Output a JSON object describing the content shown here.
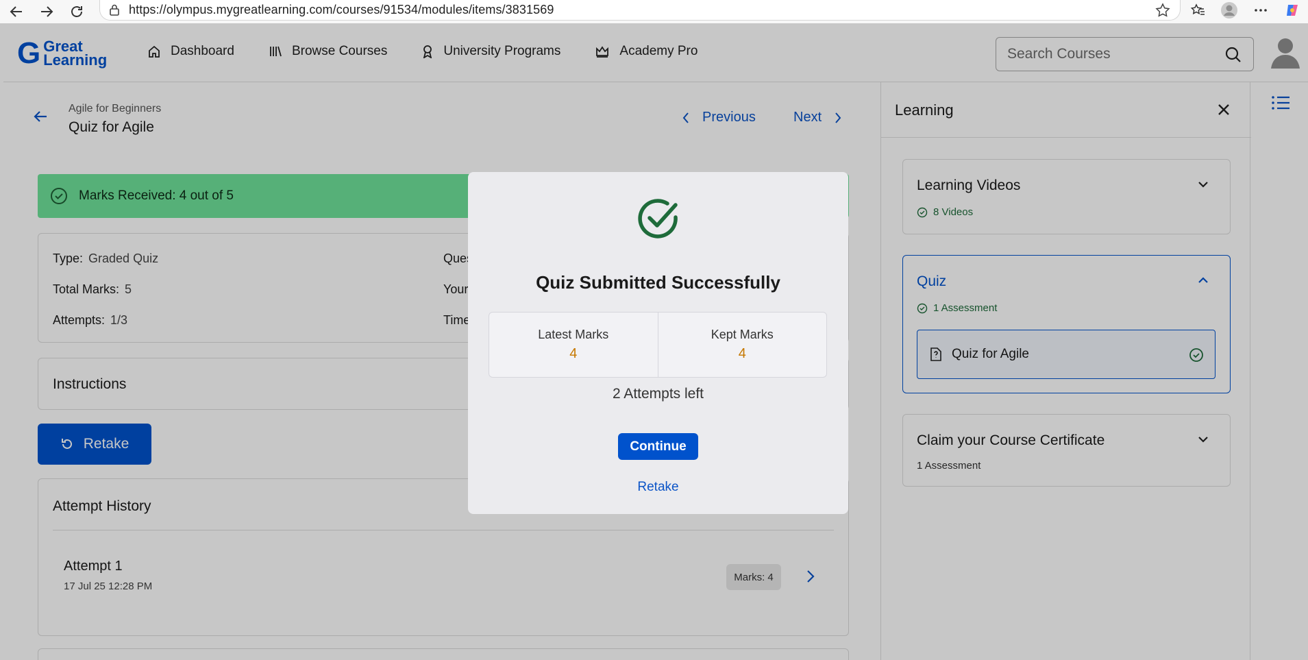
{
  "browser": {
    "url": "https://olympus.mygreatlearning.com/courses/91534/modules/items/3831569"
  },
  "header": {
    "logo_line1": "Great",
    "logo_line2": "Learning",
    "nav": [
      {
        "label": "Dashboard",
        "icon": "home-icon"
      },
      {
        "label": "Browse Courses",
        "icon": "library-icon"
      },
      {
        "label": "University Programs",
        "icon": "award-icon"
      },
      {
        "label": "Academy Pro",
        "icon": "crown-icon"
      }
    ],
    "search_placeholder": "Search Courses"
  },
  "main": {
    "breadcrumb": "Agile for Beginners",
    "title": "Quiz for Agile",
    "prev_label": "Previous",
    "next_label": "Next",
    "marks_banner": "Marks Received: 4 out of 5",
    "info": {
      "type_label": "Type:",
      "type_value": "Graded Quiz",
      "total_label": "Total Marks:",
      "total_value": "5",
      "attempts_label": "Attempts:",
      "attempts_value": "1/3",
      "questions_label_partial": "Ques",
      "your_label_partial": "Your",
      "time_label_partial": "Time"
    },
    "instructions_title": "Instructions",
    "retake_label": "Retake",
    "history": {
      "title": "Attempt History",
      "attempts": [
        {
          "name": "Attempt 1",
          "date": "17 Jul 25 12:28 PM",
          "marks": "Marks: 4"
        }
      ]
    }
  },
  "sidebar": {
    "title": "Learning",
    "sections": [
      {
        "title": "Learning Videos",
        "sub": "8 Videos",
        "expanded": false
      },
      {
        "title": "Quiz",
        "sub": "1 Assessment",
        "expanded": true,
        "items": [
          {
            "label": "Quiz for Agile",
            "completed": true
          }
        ]
      },
      {
        "title": "Claim your Course Certificate",
        "sub": "1 Assessment",
        "expanded": false
      }
    ]
  },
  "modal": {
    "title": "Quiz Submitted Successfully",
    "latest_label": "Latest Marks",
    "latest_value": "4",
    "kept_label": "Kept Marks",
    "kept_value": "4",
    "attempts_left": "2 Attempts left",
    "continue_label": "Continue",
    "retake_label": "Retake"
  },
  "colors": {
    "brand": "#0052cc",
    "success_banner": "#6fe29a",
    "success_icon": "#1e7a3e",
    "marks_value": "#c67800"
  }
}
